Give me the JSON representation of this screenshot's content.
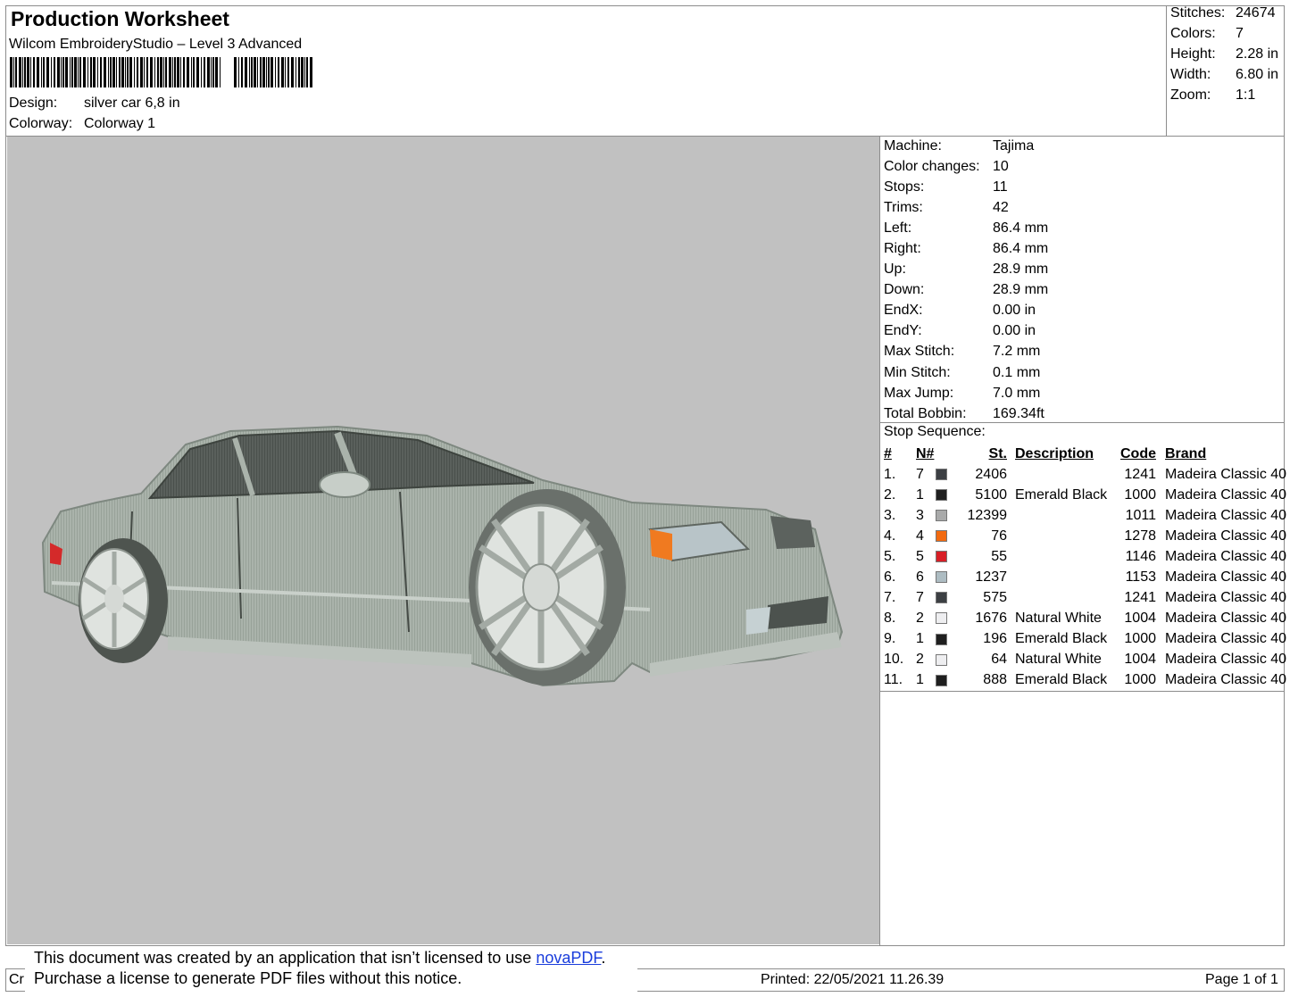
{
  "header": {
    "title": "Production Worksheet",
    "software": "Wilcom EmbroideryStudio – Level 3 Advanced",
    "design_label": "Design:",
    "design_value": "silver car 6,8 in",
    "colorway_label": "Colorway:",
    "colorway_value": "Colorway 1"
  },
  "stats": [
    {
      "label": "Stitches:",
      "value": "24674"
    },
    {
      "label": "Colors:",
      "value": "7"
    },
    {
      "label": "Height:",
      "value": "2.28 in"
    },
    {
      "label": "Width:",
      "value": "6.80 in"
    },
    {
      "label": "Zoom:",
      "value": "1:1"
    }
  ],
  "machine_info": [
    {
      "label": "Machine:",
      "value": "Tajima"
    },
    {
      "label": "Color changes:",
      "value": "10"
    },
    {
      "label": "Stops:",
      "value": "11"
    },
    {
      "label": "Trims:",
      "value": "42"
    },
    {
      "label": "Left:",
      "value": "86.4 mm"
    },
    {
      "label": "Right:",
      "value": "86.4 mm"
    },
    {
      "label": "Up:",
      "value": "28.9 mm"
    },
    {
      "label": "Down:",
      "value": "28.9 mm"
    },
    {
      "label": "EndX:",
      "value": "0.00 in"
    },
    {
      "label": "EndY:",
      "value": "0.00 in"
    },
    {
      "label": "Max Stitch:",
      "value": "7.2 mm"
    },
    {
      "label": "Min Stitch:",
      "value": "0.1 mm"
    },
    {
      "label": "Max Jump:",
      "value": "7.0 mm"
    },
    {
      "label": "Total Bobbin:",
      "value": "169.34ft"
    }
  ],
  "stop_sequence": {
    "title": "Stop Sequence:",
    "headers": {
      "idx": "#",
      "n": "N#",
      "st": "St.",
      "desc": "Description",
      "code": "Code",
      "brand": "Brand"
    },
    "rows": [
      {
        "idx": "1.",
        "n": "7",
        "color": "#3c3f43",
        "st": "2406",
        "desc": "",
        "code": "1241",
        "brand": "Madeira Classic 40"
      },
      {
        "idx": "2.",
        "n": "1",
        "color": "#1f1f1f",
        "st": "5100",
        "desc": "Emerald Black",
        "code": "1000",
        "brand": "Madeira Classic 40"
      },
      {
        "idx": "3.",
        "n": "3",
        "color": "#a9aaaa",
        "st": "12399",
        "desc": "",
        "code": "1011",
        "brand": "Madeira Classic 40"
      },
      {
        "idx": "4.",
        "n": "4",
        "color": "#f26a10",
        "st": "76",
        "desc": "",
        "code": "1278",
        "brand": "Madeira Classic 40"
      },
      {
        "idx": "5.",
        "n": "5",
        "color": "#d81f26",
        "st": "55",
        "desc": "",
        "code": "1146",
        "brand": "Madeira Classic 40"
      },
      {
        "idx": "6.",
        "n": "6",
        "color": "#adbcc2",
        "st": "1237",
        "desc": "",
        "code": "1153",
        "brand": "Madeira Classic 40"
      },
      {
        "idx": "7.",
        "n": "7",
        "color": "#3c3f43",
        "st": "575",
        "desc": "",
        "code": "1241",
        "brand": "Madeira Classic 40"
      },
      {
        "idx": "8.",
        "n": "2",
        "color": "#eeeef0",
        "st": "1676",
        "desc": "Natural White",
        "code": "1004",
        "brand": "Madeira Classic 40"
      },
      {
        "idx": "9.",
        "n": "1",
        "color": "#1f1f1f",
        "st": "196",
        "desc": "Emerald Black",
        "code": "1000",
        "brand": "Madeira Classic 40"
      },
      {
        "idx": "10.",
        "n": "2",
        "color": "#eeeef0",
        "st": "64",
        "desc": "Natural White",
        "code": "1004",
        "brand": "Madeira Classic 40"
      },
      {
        "idx": "11.",
        "n": "1",
        "color": "#1f1f1f",
        "st": "888",
        "desc": "Emerald Black",
        "code": "1000",
        "brand": "Madeira Classic 40"
      }
    ]
  },
  "footer": {
    "created_stub": "Cr",
    "printed": "Printed: 22/05/2021 11.26.39",
    "page": "Page 1 of 1"
  },
  "notice": {
    "line1_prefix": "This document was created by an application that isn’t licensed to use ",
    "link_text": "novaPDF",
    "line1_suffix": ".",
    "line2": "Purchase a license to generate PDF files without this notice."
  }
}
